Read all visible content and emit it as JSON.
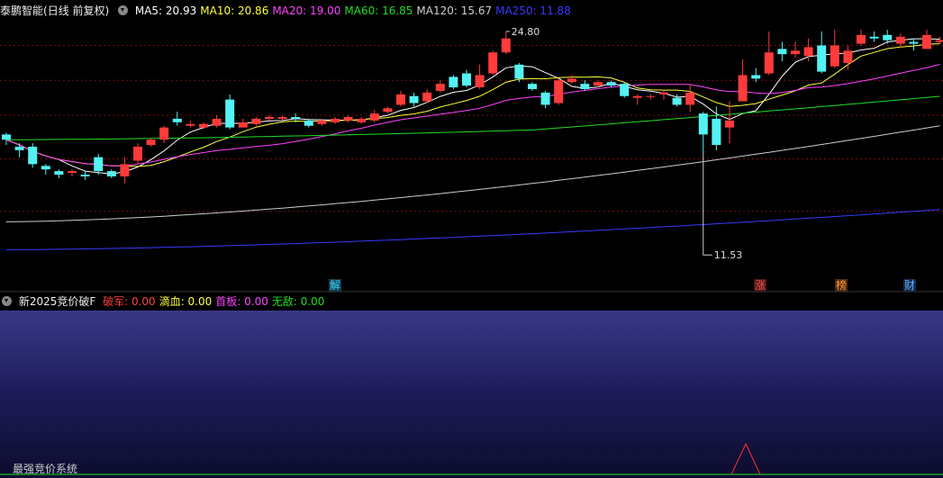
{
  "header": {
    "stock_name": "泰鹏智能",
    "period": "(日线 前复权)",
    "ma": [
      {
        "label": "MA5: 20.93",
        "color": "#ffffff"
      },
      {
        "label": "MA10: 20.86",
        "color": "#ffff3a"
      },
      {
        "label": "MA20: 19.00",
        "color": "#ff44ff"
      },
      {
        "label": "MA60: 16.85",
        "color": "#22dd22"
      },
      {
        "label": "MA120: 15.67",
        "color": "#cccccc"
      },
      {
        "label": "MA250: 11.88",
        "color": "#3a3aff"
      }
    ]
  },
  "annotations": {
    "high": "24.80",
    "low": "11.53"
  },
  "events": [
    {
      "label": "解",
      "color": "#3ad6ff",
      "bg": "#1a3a50"
    },
    {
      "label": "涨",
      "color": "#ff5050",
      "bg": "#4a1a1a"
    },
    {
      "label": "榜",
      "color": "#ff9a3a",
      "bg": "#4a2a10"
    },
    {
      "label": "财",
      "color": "#5ab0ff",
      "bg": "#1a2a4a"
    }
  ],
  "sub": {
    "indicator_name": "新2025竞价破F",
    "fields": [
      {
        "label": "破军: 0.00",
        "color": "#ff4040"
      },
      {
        "label": "滴血: 0.00",
        "color": "#ffff40"
      },
      {
        "label": "首板: 0.00",
        "color": "#ff44ff"
      },
      {
        "label": "无敌: 0.00",
        "color": "#22dd22"
      }
    ],
    "system_name": "最强竞价系统"
  },
  "colors": {
    "up": "#ff3b3b",
    "down": "#54f2f2",
    "grid": "#7a1010"
  },
  "chart_data": {
    "type": "candlestick",
    "ohlc": [
      [
        18.9,
        18.6,
        19.0,
        18.3
      ],
      [
        18.2,
        18.0,
        18.4,
        17.6
      ],
      [
        18.2,
        17.2,
        18.4,
        17.0
      ],
      [
        17.1,
        16.9,
        17.2,
        16.6
      ],
      [
        16.8,
        16.6,
        16.9,
        16.4
      ],
      [
        16.7,
        16.8,
        16.9,
        16.5
      ],
      [
        16.6,
        16.5,
        16.8,
        16.3
      ],
      [
        17.6,
        16.8,
        17.8,
        16.6
      ],
      [
        16.8,
        16.5,
        16.9,
        16.4
      ],
      [
        16.5,
        17.2,
        17.6,
        16.1
      ],
      [
        17.4,
        18.2,
        18.4,
        17.2
      ],
      [
        18.3,
        18.6,
        18.7,
        18.2
      ],
      [
        18.6,
        19.3,
        19.4,
        18.4
      ],
      [
        19.8,
        19.6,
        20.2,
        19.4
      ],
      [
        19.4,
        19.5,
        19.7,
        19.3
      ],
      [
        19.3,
        19.5,
        19.6,
        19.2
      ],
      [
        19.4,
        19.8,
        20.0,
        19.3
      ],
      [
        20.9,
        19.3,
        21.2,
        19.2
      ],
      [
        19.3,
        19.6,
        19.8,
        19.3
      ],
      [
        19.5,
        19.8,
        19.9,
        19.4
      ],
      [
        19.8,
        19.9,
        20.0,
        19.7
      ],
      [
        19.8,
        19.9,
        20.0,
        19.7
      ],
      [
        19.9,
        19.8,
        20.1,
        19.6
      ],
      [
        19.7,
        19.4,
        19.8,
        19.3
      ],
      [
        19.5,
        19.7,
        19.8,
        19.4
      ],
      [
        19.6,
        19.8,
        19.9,
        19.5
      ],
      [
        19.7,
        19.9,
        20.0,
        19.6
      ],
      [
        19.6,
        19.8,
        19.9,
        19.5
      ],
      [
        19.7,
        20.1,
        20.3,
        19.6
      ],
      [
        20.2,
        20.4,
        20.5,
        20.1
      ],
      [
        20.6,
        21.2,
        21.4,
        20.5
      ],
      [
        21.1,
        20.7,
        21.3,
        20.5
      ],
      [
        20.8,
        21.3,
        21.5,
        20.7
      ],
      [
        21.4,
        21.8,
        22.0,
        21.3
      ],
      [
        22.2,
        21.6,
        22.3,
        21.5
      ],
      [
        22.4,
        21.7,
        22.6,
        21.6
      ],
      [
        21.6,
        22.3,
        22.9,
        21.5
      ],
      [
        22.4,
        23.6,
        23.7,
        22.3
      ],
      [
        23.6,
        24.4,
        24.8,
        23.5
      ],
      [
        22.9,
        22.1,
        23.0,
        21.9
      ],
      [
        21.8,
        21.5,
        21.9,
        21.4
      ],
      [
        21.3,
        20.6,
        21.4,
        20.4
      ],
      [
        20.7,
        22.0,
        22.1,
        20.6
      ],
      [
        21.9,
        22.1,
        22.3,
        21.8
      ],
      [
        21.8,
        21.5,
        22.0,
        21.4
      ],
      [
        21.7,
        21.9,
        22.0,
        21.6
      ],
      [
        21.9,
        21.7,
        22.0,
        21.6
      ],
      [
        21.8,
        21.1,
        21.9,
        21.0
      ],
      [
        21.0,
        21.1,
        21.2,
        20.6
      ],
      [
        21.1,
        21.1,
        21.2,
        20.9
      ],
      [
        21.2,
        21.3,
        21.4,
        20.9
      ],
      [
        21.0,
        20.6,
        21.2,
        20.5
      ],
      [
        20.6,
        21.3,
        21.8,
        20.2
      ],
      [
        20.1,
        18.9,
        20.2,
        17.9
      ],
      [
        19.8,
        18.3,
        20.5,
        18.0
      ],
      [
        19.3,
        19.7,
        20.8,
        18.4
      ],
      [
        20.8,
        22.3,
        23.2,
        21.0
      ],
      [
        22.3,
        22.1,
        22.7,
        21.9
      ],
      [
        22.4,
        23.6,
        24.8,
        22.3
      ],
      [
        23.8,
        23.5,
        24.2,
        23.1
      ],
      [
        23.5,
        23.7,
        24.2,
        23.3
      ],
      [
        23.4,
        23.9,
        24.4,
        23.1
      ],
      [
        24.0,
        22.5,
        24.8,
        22.4
      ],
      [
        22.8,
        24.0,
        24.9,
        22.7
      ],
      [
        23.0,
        23.7,
        24.0,
        22.6
      ],
      [
        24.1,
        24.6,
        24.9,
        24.0
      ],
      [
        24.5,
        24.4,
        24.8,
        24.2
      ],
      [
        24.6,
        24.3,
        24.9,
        24.1
      ],
      [
        24.1,
        24.5,
        24.7,
        23.9
      ],
      [
        24.2,
        24.1,
        24.4,
        23.7
      ],
      [
        23.8,
        24.6,
        24.9,
        23.8
      ],
      [
        24.2,
        24.3,
        24.5,
        24.1
      ]
    ]
  }
}
